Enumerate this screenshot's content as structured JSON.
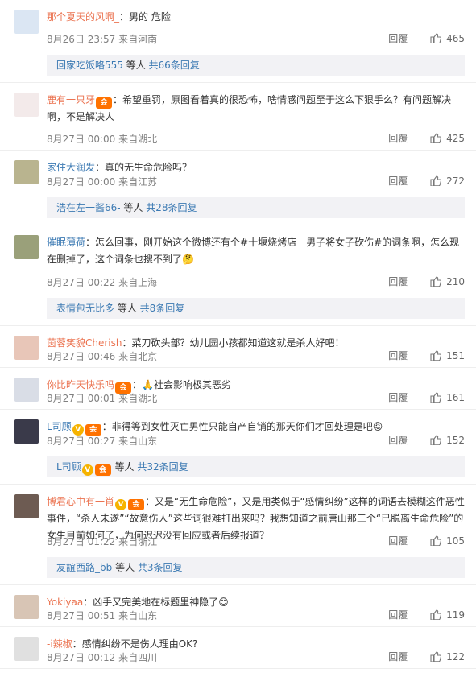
{
  "comments": [
    {
      "user": "那个夏天的风啊_",
      "sep": "：",
      "badges": [],
      "text": "男的 危险",
      "time": "8月26日 23:57",
      "source": "来自河南",
      "likes": "465",
      "sub": {
        "name": "回家吃饭咯555",
        "mid": " 等人 ",
        "count": "共66条回复"
      }
    },
    {
      "user": "鹿有一只牙",
      "sep": "",
      "badges": [
        "vip"
      ],
      "text": "：希望重罚，原图看着真的很恐怖，啥情感问题至于这么下狠手么？有问题解决啊，不是解决人",
      "time": "8月27日 00:00",
      "source": "来自湖北",
      "likes": "425"
    },
    {
      "user": "家住大润发",
      "sep": "：",
      "badges": [],
      "text": "真的无生命危险吗？",
      "time": "8月27日 00:00",
      "source": "来自江苏",
      "likes": "272",
      "sub": {
        "name": "浩在左一酱66-",
        "mid": " 等人 ",
        "count": "共28条回复"
      }
    },
    {
      "user": "催眠薄荷",
      "sep": "：",
      "badges": [],
      "text": "怎么回事，刚开始这个微博还有个#十堰烧烤店一男子将女子砍伤#的词条啊，怎么现在删掉了，这个词条也搜不到了🤔",
      "time": "8月27日 00:22",
      "source": "来自上海",
      "likes": "210",
      "sub": {
        "name": "表情包无比多",
        "mid": " 等人 ",
        "count": "共8条回复"
      }
    },
    {
      "user": "茵蓉笑貌Cherish",
      "sep": "：",
      "badges": [],
      "text": "菜刀砍头部？幼儿园小孩都知道这就是杀人好吧！",
      "time": "8月27日 00:46",
      "source": "来自北京",
      "likes": "151"
    },
    {
      "user": "你比昨天快乐吗",
      "sep": "",
      "badges": [
        "vip"
      ],
      "text": "：🙏社会影响极其恶劣",
      "time": "8月27日 00:01",
      "source": "来自湖北",
      "likes": "161"
    },
    {
      "user": "L司顾",
      "sep": "",
      "badges": [
        "v",
        "vip"
      ],
      "text": "：非得等到女性灭亡男性只能自产自销的那天你们才回处理是吧😡",
      "time": "8月27日 00:27",
      "source": "来自山东",
      "likes": "152",
      "sub": {
        "name": "L司顾",
        "mid": " 等人 ",
        "count": "共32条回复",
        "badges": [
          "v",
          "vip"
        ]
      }
    },
    {
      "user": "博君心中有一肖",
      "sep": "",
      "badges": [
        "v",
        "vip"
      ],
      "text": "：又是“无生命危险”，又是用类似于“感情纠纷”这样的词语去模糊这件恶性事件，“杀人未遂”“故意伤人”这些词很难打出来吗？我想知道之前唐山那三个“已脱离生命危险”的女生目前如何了，为何迟迟没有回应或者后续报道？",
      "time": "8月27日 01:22",
      "source": "来自浙江",
      "likes": "105",
      "sub": {
        "name": "友誼西路_bb",
        "mid": " 等人 ",
        "count": "共3条回复"
      }
    },
    {
      "user": "Yokiyaa",
      "sep": "：",
      "badges": [],
      "text": "凶手又完美地在标题里神隐了😊",
      "time": "8月27日 00:51",
      "source": "来自山东",
      "likes": "119"
    },
    {
      "user": "-i辣椒",
      "sep": "：",
      "badges": [],
      "text": "感情纠纷不是伤人理由OK?",
      "time": "8月27日 00:12",
      "source": "来自四川",
      "likes": "122"
    }
  ],
  "ui": {
    "reply_label": "回覆"
  },
  "colors": {
    "username": "#eb7350",
    "link": "#3c7ab3",
    "meta": "#808080",
    "sub_bg": "#f2f2f5"
  }
}
